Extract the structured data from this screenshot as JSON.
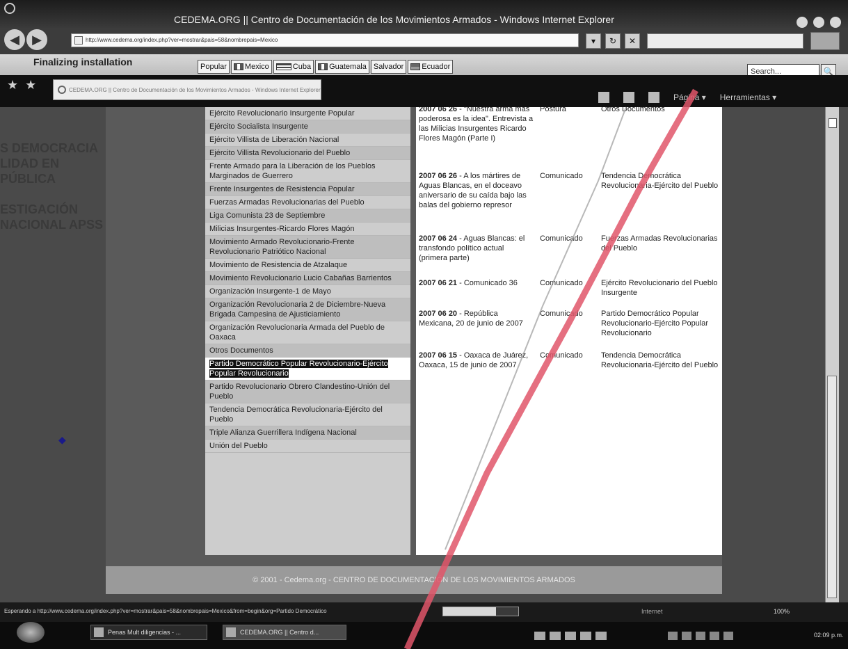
{
  "window": {
    "title": "CEDEMA.ORG || Centro de Documentación de los Movimientos Armados - Windows Internet Explorer"
  },
  "address_bar": {
    "url": "http://www.cedema.org/index.php?ver=mostrar&pais=58&nombrepais=Mexico"
  },
  "command_bar": {
    "status_title": "Finalizing installation",
    "links": [
      {
        "label": "Popular",
        "flag": ""
      },
      {
        "label": "Mexico",
        "flag": "mx"
      },
      {
        "label": "Cuba",
        "flag": "cu"
      },
      {
        "label": "Guatemala",
        "flag": "gt"
      },
      {
        "label": "Salvador",
        "flag": ""
      },
      {
        "label": "Ecuador",
        "flag": "ec"
      }
    ],
    "search_placeholder": "Search..."
  },
  "favorites_bar": {
    "toolbar": {
      "page_label": "Página",
      "tools_label": "Herramientas"
    }
  },
  "page": {
    "left_background_text": [
      "S DEMOCRACIA",
      "LIDAD EN",
      "PÚBLICA",
      "",
      "ESTIGACIÓN",
      "NACIONAL APSS"
    ],
    "sidebar_items": [
      {
        "label": "Ejército Revolucionario Insurgente Popular",
        "style": ""
      },
      {
        "label": "Ejército Socialista Insurgente",
        "style": "alt"
      },
      {
        "label": "Ejército Villista de Liberación Nacional",
        "style": ""
      },
      {
        "label": "Ejército Villista Revolucionario del Pueblo",
        "style": "alt"
      },
      {
        "label": "Frente Armado para la Liberación de los Pueblos Marginados de Guerrero",
        "style": ""
      },
      {
        "label": "Frente Insurgentes de Resistencia Popular",
        "style": "alt"
      },
      {
        "label": "Fuerzas Armadas Revolucionarias del Pueblo",
        "style": ""
      },
      {
        "label": "Liga Comunista 23 de Septiembre",
        "style": "alt"
      },
      {
        "label": "Milicias Insurgentes-Ricardo Flores Magón",
        "style": ""
      },
      {
        "label": "Movimiento Armado Revolucionario-Frente Revolucionario Patriótico Nacional",
        "style": "alt"
      },
      {
        "label": "Movimiento de Resistencia de Atzalaque",
        "style": ""
      },
      {
        "label": "Movimiento Revolucionario Lucio Cabañas Barrientos",
        "style": "alt"
      },
      {
        "label": "Organización Insurgente-1 de Mayo",
        "style": ""
      },
      {
        "label": "Organización Revolucionaria 2 de Diciembre-Nueva Brigada Campesina de Ajusticiamiento",
        "style": "alt"
      },
      {
        "label": "Organización Revolucionaria Armada del Pueblo de Oaxaca",
        "style": ""
      },
      {
        "label": "Otros Documentos",
        "style": "alt"
      },
      {
        "label": "Partido Democrático Popular Revolucionario-Ejército Popular Revolucionario",
        "style": "sel"
      },
      {
        "label": "Partido Revolucionario Obrero Clandestino-Unión del Pueblo",
        "style": "alt"
      },
      {
        "label": "Tendencia Democrática Revolucionaria-Ejército del Pueblo",
        "style": ""
      },
      {
        "label": "Triple Alianza Guerrillera Indígena Nacional",
        "style": "alt"
      },
      {
        "label": "Unión del Pueblo",
        "style": ""
      }
    ],
    "documents": [
      {
        "date": "2007 06 26",
        "title": "\"Nuestra arma más poderosa es la idea\". Entrevista a las Milicias Insurgentes Ricardo Flores Magón (Parte I)",
        "type": "Postura",
        "org": "Otros Documentos"
      },
      {
        "date": "2007 06 26",
        "title": "A los mártires de Aguas Blancas, en el doceavo aniversario de su caída bajo las balas del gobierno represor",
        "type": "Comunicado",
        "org": "Tendencia Democrática Revolucionaria-Ejército del Pueblo"
      },
      {
        "date": "2007 06 24",
        "title": "Aguas Blancas: el transfondo político actual (primera parte)",
        "type": "Comunicado",
        "org": "Fuerzas Armadas Revolucionarias del Pueblo"
      },
      {
        "date": "2007 06 21",
        "title": "Comunicado 36",
        "type": "Comunicado",
        "org": "Ejército Revolucionario del Pueblo Insurgente"
      },
      {
        "date": "2007 06 20",
        "title": "República Mexicana, 20 de junio de 2007",
        "type": "Comunicado",
        "org": "Partido Democrático Popular Revolucionario-Ejército Popular Revolucionario"
      },
      {
        "date": "2007 06 15",
        "title": "Oaxaca de Juárez, Oaxaca, 15 de junio de 2007",
        "type": "Comunicado",
        "org": "Tendencia Democrática Revolucionaria-Ejército del Pueblo"
      }
    ],
    "footer": "© 2001 - Cedema.org - CENTRO DE DOCUMENTACIÓN DE LOS MOVIMIENTOS ARMADOS"
  },
  "status_bar": {
    "message": "Esperando a http://www.cedema.org/index.php?ver=mostrar&pais=58&nombrepais=Mexico&from=begin&org=Partido Democrático",
    "progress": 0.7,
    "zone": "Internet",
    "zoom": "100%"
  },
  "taskbar": {
    "tasks": [
      {
        "label": "Penas Mult diligencias - ..."
      },
      {
        "label": "CEDEMA.ORG || Centro d..."
      }
    ],
    "clock": "02:09 p.m."
  }
}
